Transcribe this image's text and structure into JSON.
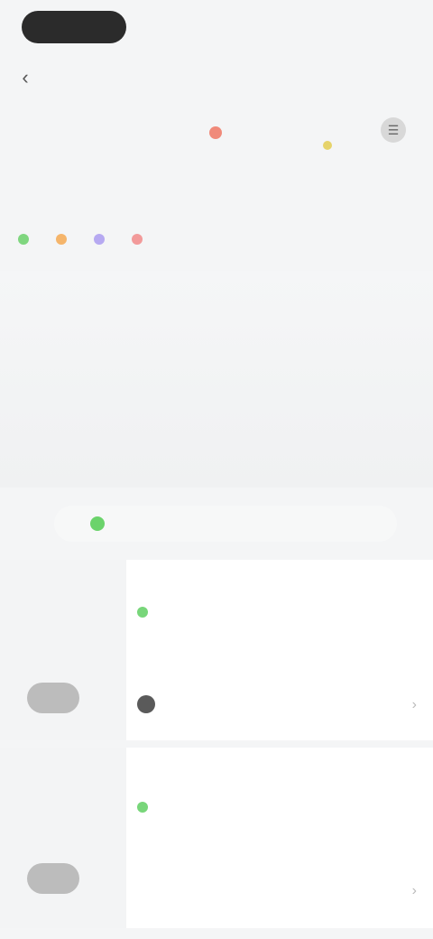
{
  "status": {
    "pill_label": "",
    "right_text": ""
  },
  "header": {
    "back_glyph": "‹",
    "subtitle": "",
    "stat_label": "",
    "stat_icon": "☰"
  },
  "section": {
    "title": ""
  },
  "legend": [
    {
      "label": "",
      "color": "#7fd67f"
    },
    {
      "label": "",
      "color": "#f5b56b"
    },
    {
      "label": "",
      "color": "#b6a9f1"
    },
    {
      "label": "",
      "color": "#f29a9a"
    }
  ],
  "route": {
    "text": ""
  },
  "cards": [
    {
      "title": "",
      "info": "",
      "footer": "",
      "arrow": "›"
    },
    {
      "title": "",
      "info": "",
      "sub": "",
      "arrow": "›"
    }
  ]
}
